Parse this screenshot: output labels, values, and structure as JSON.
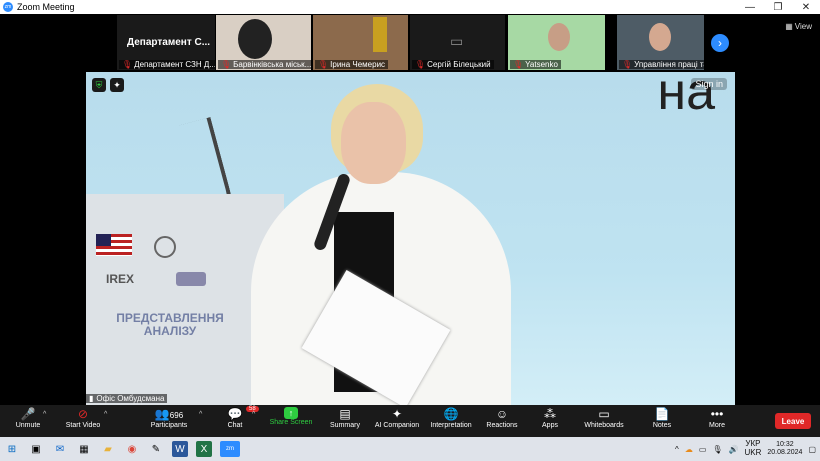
{
  "window": {
    "title": "Zoom Meeting",
    "logo_text": "zm"
  },
  "gallery": {
    "first_tile_big_name": "Департамент С...",
    "participants": [
      {
        "name": "Департамент СЗН Д..."
      },
      {
        "name": "Барвінківська міськ..."
      },
      {
        "name": "Ірина Чемерис"
      },
      {
        "name": "Сергій Білецький"
      },
      {
        "name": "Yatsenko"
      },
      {
        "name": "Управління праці та ..."
      }
    ],
    "view_label": "View"
  },
  "main_video": {
    "speaker_name": "Офіс Омбудсмана",
    "signin_label": "Sign in",
    "background_text": "на",
    "podium_logo": "IREX",
    "podium_title": "ПРЕДСТАВЛЕННЯ АНАЛІЗУ"
  },
  "toolbar": {
    "unmute": "Unmute",
    "start_video": "Start Video",
    "participants": "Participants",
    "participants_count": "696",
    "chat": "Chat",
    "chat_badge": "58",
    "share_screen": "Share Screen",
    "summary": "Summary",
    "ai_companion": "AI Companion",
    "interpretation": "Interpretation",
    "reactions": "Reactions",
    "apps": "Apps",
    "whiteboards": "Whiteboards",
    "notes": "Notes",
    "more": "More",
    "leave": "Leave"
  },
  "taskbar": {
    "lang_top": "УКР",
    "lang_bottom": "UKR",
    "time": "10:32",
    "date": "20.08.2024",
    "zoom_icon_text": "zm"
  },
  "colors": {
    "accent": "#2d8cff",
    "share_green": "#2ecc40",
    "leave_red": "#e02828"
  }
}
